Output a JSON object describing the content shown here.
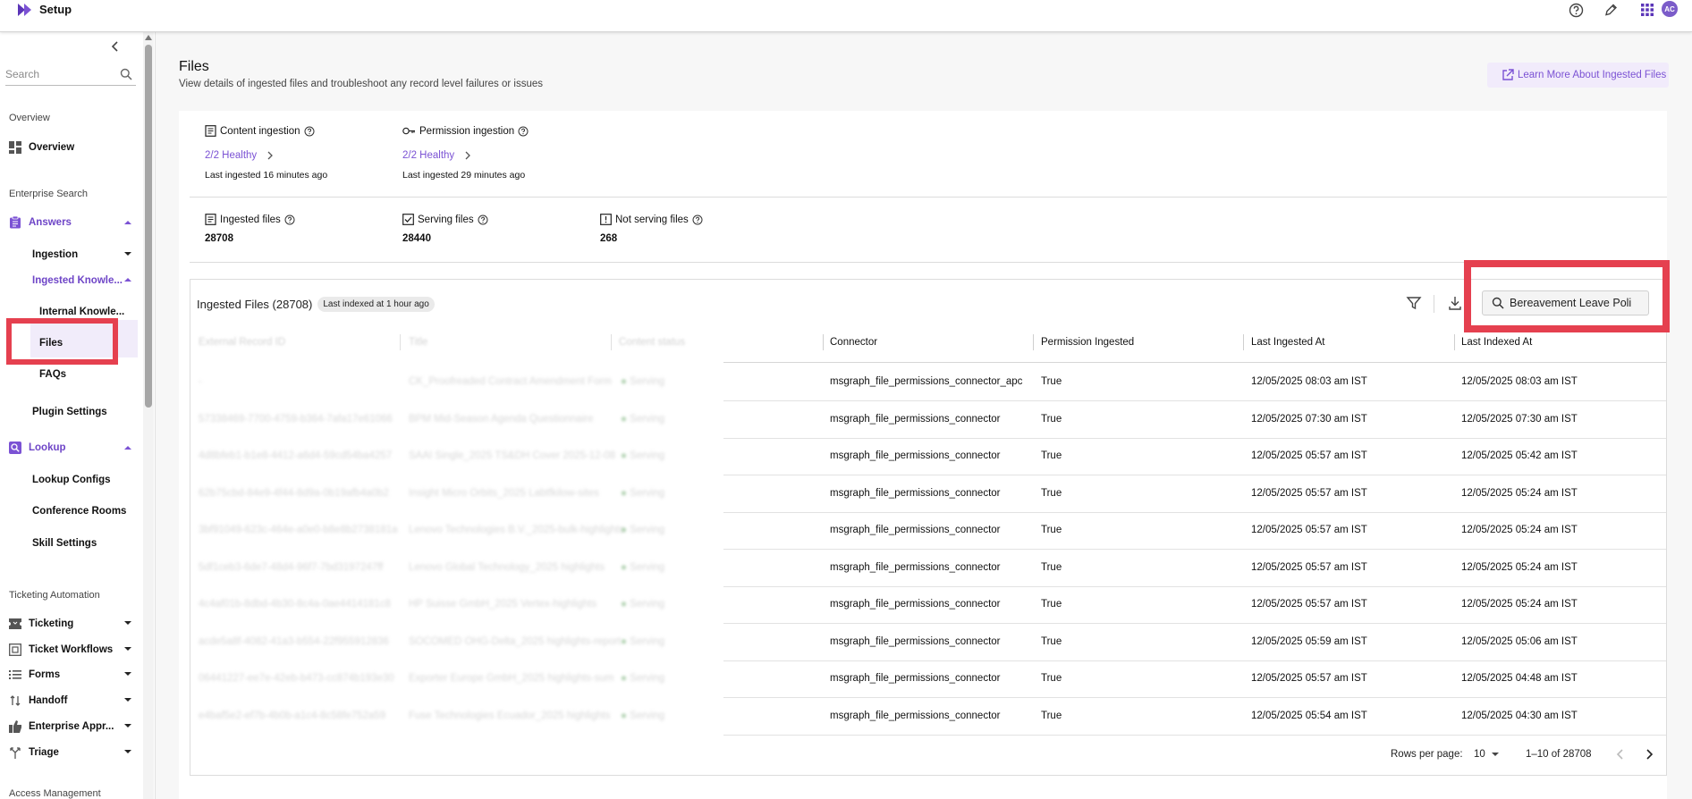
{
  "topbar": {
    "title": "Setup",
    "avatar_initials": "AC",
    "icons": [
      "help-icon",
      "edit-icon",
      "apps-grid-icon"
    ]
  },
  "sidebar": {
    "search_placeholder": "Search",
    "sections": {
      "overview": "Overview",
      "enterprise_search": "Enterprise Search",
      "ticketing_automation": "Ticketing Automation",
      "access_management": "Access Management"
    },
    "items": {
      "overview": "Overview",
      "answers": "Answers",
      "ingestion": "Ingestion",
      "ingested_knowledge": "Ingested Knowle...",
      "internal_knowledge": "Internal Knowle...",
      "files": "Files",
      "faqs": "FAQs",
      "plugin_settings": "Plugin Settings",
      "lookup": "Lookup",
      "lookup_configs": "Lookup Configs",
      "conference_rooms": "Conference Rooms",
      "skill_settings": "Skill Settings",
      "ticketing": "Ticketing",
      "ticket_workflows": "Ticket Workflows",
      "forms": "Forms",
      "handoff": "Handoff",
      "enterprise_approvals": "Enterprise Appr...",
      "triage": "Triage"
    }
  },
  "page": {
    "title": "Files",
    "subtitle": "View details of ingested files and troubleshoot any record level failures or issues",
    "learn_more": "Learn More About Ingested Files"
  },
  "stats": {
    "content_ingestion": {
      "label": "Content ingestion",
      "health": "2/2 Healthy",
      "last": "Last ingested 16 minutes ago"
    },
    "permission_ingestion": {
      "label": "Permission ingestion",
      "health": "2/2 Healthy",
      "last": "Last ingested 29 minutes ago"
    },
    "ingested_files": {
      "label": "Ingested files",
      "value": "28708"
    },
    "serving_files": {
      "label": "Serving files",
      "value": "28440"
    },
    "not_serving_files": {
      "label": "Not serving files",
      "value": "268"
    }
  },
  "table": {
    "title": "Ingested Files (28708)",
    "chip": "Last indexed at 1 hour ago",
    "search_value": "Bereavement Leave Poli",
    "columns": [
      "External Record ID",
      "Title",
      "Content status",
      "Connector",
      "Permission Ingested",
      "Last Ingested At",
      "Last Indexed At"
    ],
    "rows": [
      {
        "id": "-",
        "title": "CK_Proofreaded Contract Amendment Form",
        "status": "Serving",
        "connector": "msgraph_file_permissions_connector_apc",
        "perm": "True",
        "ingested": "12/05/2025 08:03 am IST",
        "indexed": "12/05/2025 08:03 am IST"
      },
      {
        "id": "57338469-7700-4759-b364-7afa17e61066",
        "title": "BPM Mid-Season Agenda Questionnaire",
        "status": "Serving",
        "connector": "msgraph_file_permissions_connector",
        "perm": "True",
        "ingested": "12/05/2025 07:30 am IST",
        "indexed": "12/05/2025 07:30 am IST"
      },
      {
        "id": "4d8bfeb1-b1e8-4412-a6d4-59cd54ba4257",
        "title": "SAAI Single_2025 TS&DH Cover 2025-12-08",
        "status": "Serving",
        "connector": "msgraph_file_permissions_connector",
        "perm": "True",
        "ingested": "12/05/2025 05:57 am IST",
        "indexed": "12/05/2025 05:42 am IST"
      },
      {
        "id": "62b75cbd-84e9-4f44-8d9a-0b19afb4a0b2",
        "title": "Insight Micro Orbits_2025 Labtfkilow-sites",
        "status": "Serving",
        "connector": "msgraph_file_permissions_connector",
        "perm": "True",
        "ingested": "12/05/2025 05:57 am IST",
        "indexed": "12/05/2025 05:24 am IST"
      },
      {
        "id": "3bf91049-623c-464e-a0e0-b8e8b2738181a",
        "title": "Lenovo Technologies B.V._2025-bulk-highlights",
        "status": "Serving",
        "connector": "msgraph_file_permissions_connector",
        "perm": "True",
        "ingested": "12/05/2025 05:57 am IST",
        "indexed": "12/05/2025 05:24 am IST"
      },
      {
        "id": "5df1ceb3-6de7-48d4-96f7-7bd3197247ff",
        "title": "Lenovo Global Technology_2025 highlights",
        "status": "Serving",
        "connector": "msgraph_file_permissions_connector",
        "perm": "True",
        "ingested": "12/05/2025 05:57 am IST",
        "indexed": "12/05/2025 05:24 am IST"
      },
      {
        "id": "4c4af01b-8dbd-4b30-8c4a-0ae4414181c8",
        "title": "HP Suisse GmbH_2025 Vertex-highlights",
        "status": "Serving",
        "connector": "msgraph_file_permissions_connector",
        "perm": "True",
        "ingested": "12/05/2025 05:57 am IST",
        "indexed": "12/05/2025 05:24 am IST"
      },
      {
        "id": "acde5a8f-4082-41a3-b554-22f955912836",
        "title": "SOCOMED OHG-Delta_2025 highlights-report",
        "status": "Serving",
        "connector": "msgraph_file_permissions_connector",
        "perm": "True",
        "ingested": "12/05/2025 05:59 am IST",
        "indexed": "12/05/2025 05:06 am IST"
      },
      {
        "id": "06441227-ee7e-42eb-b473-cc874b193e30",
        "title": "Exporter Europe GmbH_2025 highlights-sum",
        "status": "Serving",
        "connector": "msgraph_file_permissions_connector",
        "perm": "True",
        "ingested": "12/05/2025 05:57 am IST",
        "indexed": "12/05/2025 04:48 am IST"
      },
      {
        "id": "e4baf5e2-ef7b-4b0b-a1c4-8c58fe752a59",
        "title": "Fuse Technologies Ecuador_2025 highlights",
        "status": "Serving",
        "connector": "msgraph_file_permissions_connector",
        "perm": "True",
        "ingested": "12/05/2025 05:54 am IST",
        "indexed": "12/05/2025 04:30 am IST"
      }
    ]
  },
  "pagination": {
    "rows_per_page_label": "Rows per page:",
    "rows_per_page": "10",
    "range": "1–10 of 28708"
  },
  "colors": {
    "accent": "#7b52d4",
    "highlight_box": "#e5404f"
  }
}
